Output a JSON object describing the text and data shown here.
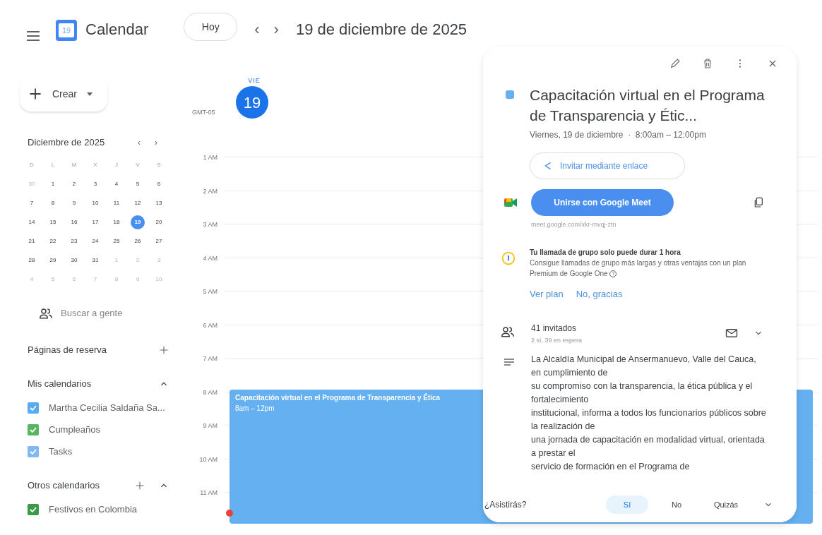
{
  "app": {
    "name": "Calendar",
    "logo_day": "19"
  },
  "toolbar": {
    "today_button": "Hoy",
    "prev": "‹",
    "next": "›",
    "date_title": "19 de diciembre de 2025"
  },
  "create_button": {
    "label": "Crear"
  },
  "mini_calendar": {
    "title": "Diciembre de 2025",
    "prev": "‹",
    "next": "›",
    "weekdays": [
      "D",
      "L",
      "M",
      "X",
      "J",
      "V",
      "S"
    ],
    "weeks": [
      [
        {
          "day": "30",
          "other_month": true,
          "selected": false
        },
        {
          "day": "1",
          "other_month": false,
          "selected": false
        },
        {
          "day": "2",
          "other_month": false,
          "selected": false
        },
        {
          "day": "3",
          "other_month": false,
          "selected": false
        },
        {
          "day": "4",
          "other_month": false,
          "selected": false
        },
        {
          "day": "5",
          "other_month": false,
          "selected": false
        },
        {
          "day": "6",
          "other_month": false,
          "selected": false
        }
      ],
      [
        {
          "day": "7",
          "other_month": false,
          "selected": false
        },
        {
          "day": "8",
          "other_month": false,
          "selected": false
        },
        {
          "day": "9",
          "other_month": false,
          "selected": false
        },
        {
          "day": "10",
          "other_month": false,
          "selected": false
        },
        {
          "day": "11",
          "other_month": false,
          "selected": false
        },
        {
          "day": "12",
          "other_month": false,
          "selected": false
        },
        {
          "day": "13",
          "other_month": false,
          "selected": false
        }
      ],
      [
        {
          "day": "14",
          "other_month": false,
          "selected": false
        },
        {
          "day": "15",
          "other_month": false,
          "selected": false
        },
        {
          "day": "16",
          "other_month": false,
          "selected": false
        },
        {
          "day": "17",
          "other_month": false,
          "selected": false
        },
        {
          "day": "18",
          "other_month": false,
          "selected": false
        },
        {
          "day": "19",
          "other_month": false,
          "selected": true
        },
        {
          "day": "20",
          "other_month": false,
          "selected": false
        }
      ],
      [
        {
          "day": "21",
          "other_month": false,
          "selected": false
        },
        {
          "day": "22",
          "other_month": false,
          "selected": false
        },
        {
          "day": "23",
          "other_month": false,
          "selected": false
        },
        {
          "day": "24",
          "other_month": false,
          "selected": false
        },
        {
          "day": "25",
          "other_month": false,
          "selected": false
        },
        {
          "day": "26",
          "other_month": false,
          "selected": false
        },
        {
          "day": "27",
          "other_month": false,
          "selected": false
        }
      ],
      [
        {
          "day": "28",
          "other_month": false,
          "selected": false
        },
        {
          "day": "29",
          "other_month": false,
          "selected": false
        },
        {
          "day": "30",
          "other_month": false,
          "selected": false
        },
        {
          "day": "31",
          "other_month": false,
          "selected": false
        },
        {
          "day": "1",
          "other_month": true,
          "selected": false
        },
        {
          "day": "2",
          "other_month": true,
          "selected": false
        },
        {
          "day": "3",
          "other_month": true,
          "selected": false
        }
      ],
      [
        {
          "day": "4",
          "other_month": true,
          "selected": false
        },
        {
          "day": "5",
          "other_month": true,
          "selected": false
        },
        {
          "day": "6",
          "other_month": true,
          "selected": false
        },
        {
          "day": "7",
          "other_month": true,
          "selected": false
        },
        {
          "day": "8",
          "other_month": true,
          "selected": false
        },
        {
          "day": "9",
          "other_month": true,
          "selected": false
        },
        {
          "day": "10",
          "other_month": true,
          "selected": false
        }
      ]
    ]
  },
  "people_search": {
    "placeholder": "Buscar a gente"
  },
  "sections": [
    {
      "title": "Páginas de reserva",
      "buttons": [
        {
          "kind": "add"
        }
      ]
    },
    {
      "title": "Mis calendarios",
      "buttons": [
        {
          "kind": "collapse"
        }
      ],
      "items": [
        {
          "label": "Martha Cecilia Saldaña Sa...",
          "checked": true,
          "color": "#5aaaf0"
        },
        {
          "label": "Cumpleaños",
          "checked": true,
          "color": "#58b562"
        },
        {
          "label": "Tasks",
          "checked": true,
          "color": "#80b8f2"
        }
      ]
    },
    {
      "title": "Otros calendarios",
      "buttons": [
        {
          "kind": "add"
        },
        {
          "kind": "collapse"
        }
      ],
      "items": [
        {
          "label": "Festivos en Colombia",
          "checked": true,
          "color": "#3a9a4a"
        }
      ]
    }
  ],
  "day_header": {
    "weekday": "VIE",
    "day": "19",
    "timezone": "GMT-05"
  },
  "hours": [
    "1 AM",
    "2 AM",
    "3 AM",
    "4 AM",
    "5 AM",
    "6 AM",
    "7 AM",
    "8 AM",
    "9 AM",
    "10 AM",
    "11 AM"
  ],
  "event": {
    "title": "Capacitación virtual en el Programa de Transparencia y Ética",
    "time": "8am – 12pm",
    "color": "#64b0f0"
  },
  "details": {
    "title": "Capacitación virtual en el Programa de Transparencia y Étic...",
    "when": "Viernes, 19 de diciembre  ·  8:00am – 12:00pm",
    "invite_link": "Invitar mediante enlace",
    "meet_button": "Unirse con Google Meet",
    "meet_url": "meet.google.com/xkr-mvqj-ztn",
    "promo": {
      "title": "Tu llamada de grupo solo puede durar 1 hora",
      "body": "Consigue llamadas de grupo más largas y otras ventajas con un plan Premium de Google One",
      "help": "?",
      "actions": [
        "Ver plan",
        "No, gracias"
      ]
    },
    "guests": {
      "count": "41 invitados",
      "summary": "2 sí, 39 en espera"
    },
    "description": [
      "La Alcaldía Municipal de Ansermanuevo, Valle del Cauca, en cumplimiento de",
      "su compromiso con la transparencia, la ética pública y el fortalecimiento",
      "institucional, informa a todos los funcionarios públicos sobre la realización de",
      "una jornada de capacitación en modalidad virtual, orientada a prestar el",
      "servicio de formación en el Programa de"
    ],
    "rsvp": {
      "question": "¿Asistirás?",
      "options": [
        {
          "label": "Sí",
          "selected": true
        },
        {
          "label": "No",
          "selected": false
        },
        {
          "label": "Quizás",
          "selected": false
        }
      ]
    }
  }
}
